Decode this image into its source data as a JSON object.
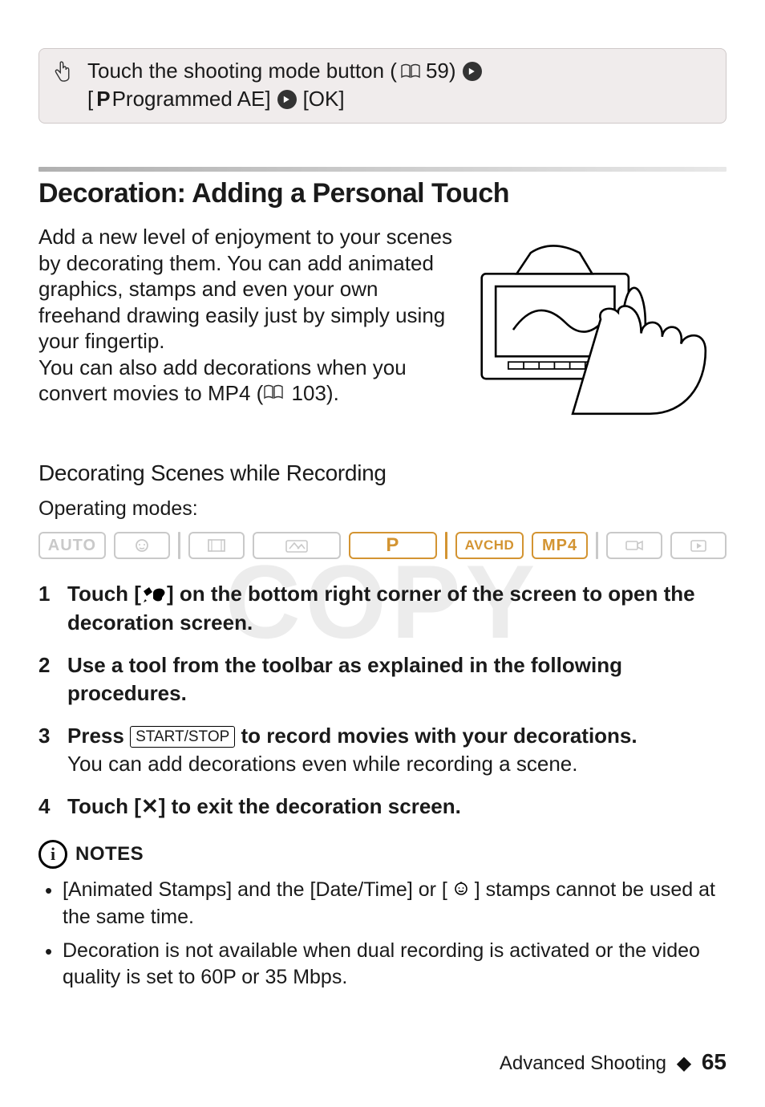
{
  "callout": {
    "pre": "Touch the shooting mode button (",
    "ref": "59)",
    "line2_pre": "[",
    "p": "P",
    "line2_mid": " Programmed AE] ",
    "line2_ok": " [OK]"
  },
  "section_title": "Decoration: Adding a Personal Touch",
  "intro_p1": "Add a new level of enjoyment to your scenes by decorating them. You can add animated graphics, stamps and even your own freehand drawing easily just by simply using your fingertip.",
  "intro_p2_pre": "You can also add decorations when you convert movies to MP4 (",
  "intro_p2_ref": "103).",
  "sub_heading": "Decorating Scenes while Recording",
  "operating_label": "Operating modes:",
  "modes": {
    "auto": "AUTO",
    "p": "P",
    "avchd": "AVCHD",
    "mp4": "MP4"
  },
  "watermark": "COPY",
  "steps": [
    {
      "num": "1",
      "bold_pre": "Touch [",
      "bold_post": "] on the bottom right corner of the screen to open the decoration screen."
    },
    {
      "num": "2",
      "bold": "Use a tool from the toolbar as explained in the following procedures."
    },
    {
      "num": "3",
      "bold_pre": "Press ",
      "btn": "START/STOP",
      "bold_post": " to record movies with your decorations.",
      "sub": "You can add decorations even while recording a scene."
    },
    {
      "num": "4",
      "bold_pre": "Touch [",
      "x": "✕",
      "bold_post": "] to exit the decoration screen."
    }
  ],
  "notes_label": "NOTES",
  "notes": [
    {
      "pre": "[Animated Stamps] and the [Date/Time] or [",
      "post": "] stamps cannot be used at the same time."
    },
    {
      "text": "Decoration is not available when dual recording is activated or the video quality is set to 60P or 35 Mbps."
    }
  ],
  "footer": {
    "section": "Advanced Shooting",
    "page": "65"
  }
}
